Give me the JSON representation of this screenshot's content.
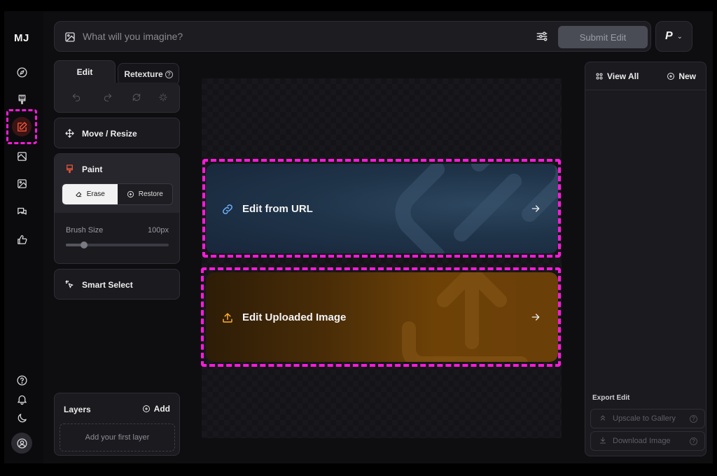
{
  "app": {
    "logo": "MJ"
  },
  "prompt": {
    "placeholder": "What will you imagine?",
    "submit_label": "Submit Edit"
  },
  "profile": {
    "initial": "P",
    "chevron": "⌄"
  },
  "tabs": {
    "edit": "Edit",
    "retexture": "Retexture",
    "help": "?"
  },
  "tools": {
    "move": "Move / Resize",
    "paint": "Paint",
    "erase": "Erase",
    "restore": "Restore",
    "brush_label": "Brush Size",
    "brush_value": "100px",
    "brush_level": 0.18,
    "smart": "Smart Select"
  },
  "layers": {
    "title": "Layers",
    "add": "Add",
    "empty": "Add your first layer"
  },
  "canvas": {
    "url_label": "Edit from URL",
    "upload_label": "Edit Uploaded Image"
  },
  "right_panel": {
    "view_all": "View All",
    "new": "New",
    "export_title": "Export Edit",
    "upscale": "Upscale to Gallery",
    "download": "Download Image",
    "help": "?"
  },
  "colors": {
    "accent": "#ff5a3c",
    "highlight": "#ff1adb",
    "url_icon": "#6fb3ff",
    "upload_icon": "#ffae2b"
  }
}
